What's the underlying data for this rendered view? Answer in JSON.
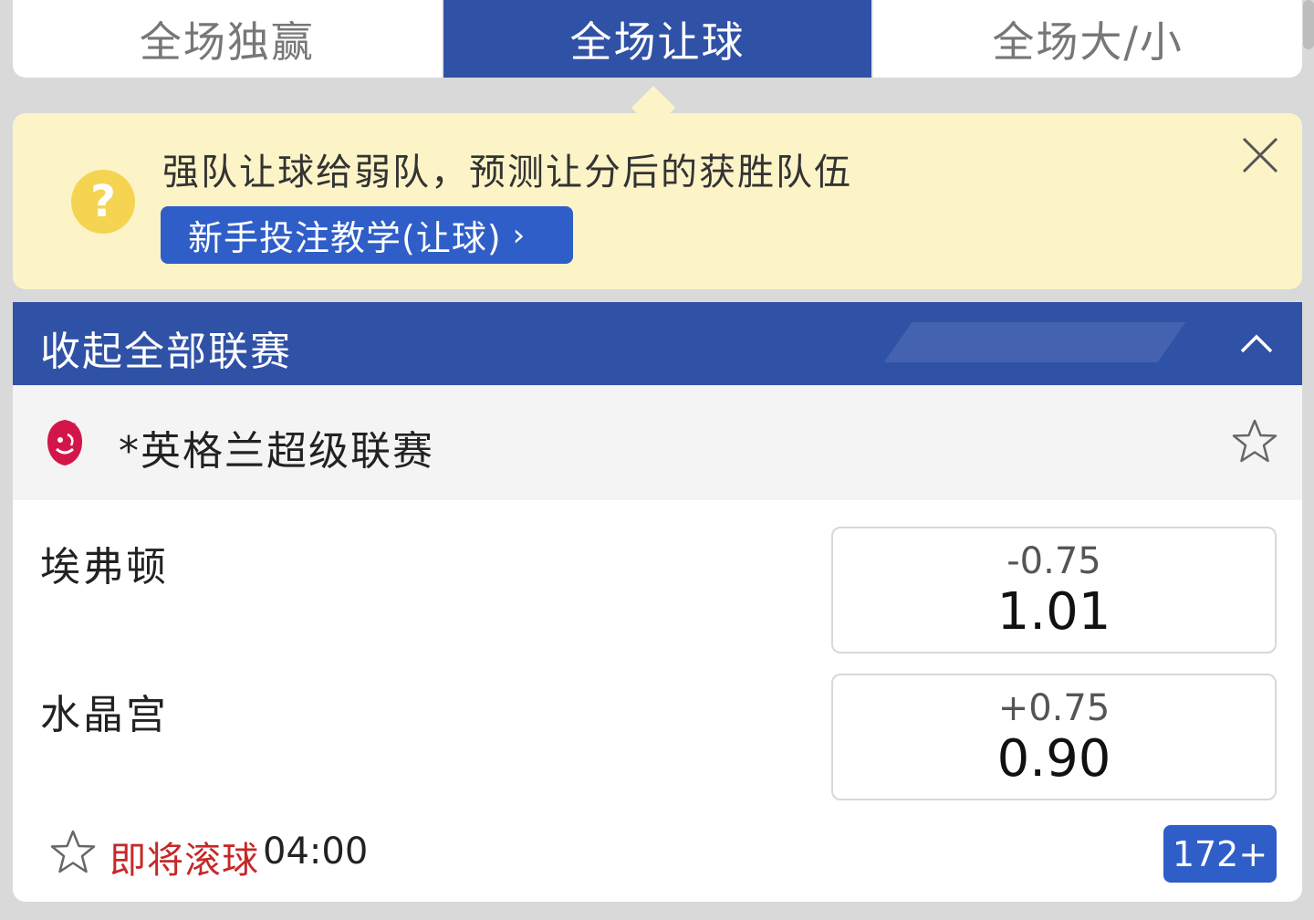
{
  "tabs": [
    {
      "label": "全场独赢"
    },
    {
      "label": "全场让球",
      "active": true
    },
    {
      "label": "全场大/小"
    }
  ],
  "hint": {
    "text": "强队让球给弱队，预测让分后的获胜队伍",
    "help_icon": "question-circle",
    "tutorial_button": "新手投注教学(让球)",
    "tutorial_chevron": "›"
  },
  "league_bar": {
    "title": "收起全部联赛"
  },
  "league": {
    "name": "*英格兰超级联赛",
    "logo_icon": "lion-crest"
  },
  "match": {
    "home": {
      "team": "埃弗顿",
      "handicap": "-0.75",
      "odds": "1.01"
    },
    "away": {
      "team": "水晶宫",
      "handicap": "+0.75",
      "odds": "0.90"
    },
    "status_label": "即将滚球",
    "status_time": "04:00",
    "more_markets": "172+"
  },
  "colors": {
    "primary": "#2f51a6",
    "button": "#2f5ec8",
    "hint_bg": "#fcf4c7",
    "help_icon": "#f5d452",
    "live_red": "#c62828"
  }
}
